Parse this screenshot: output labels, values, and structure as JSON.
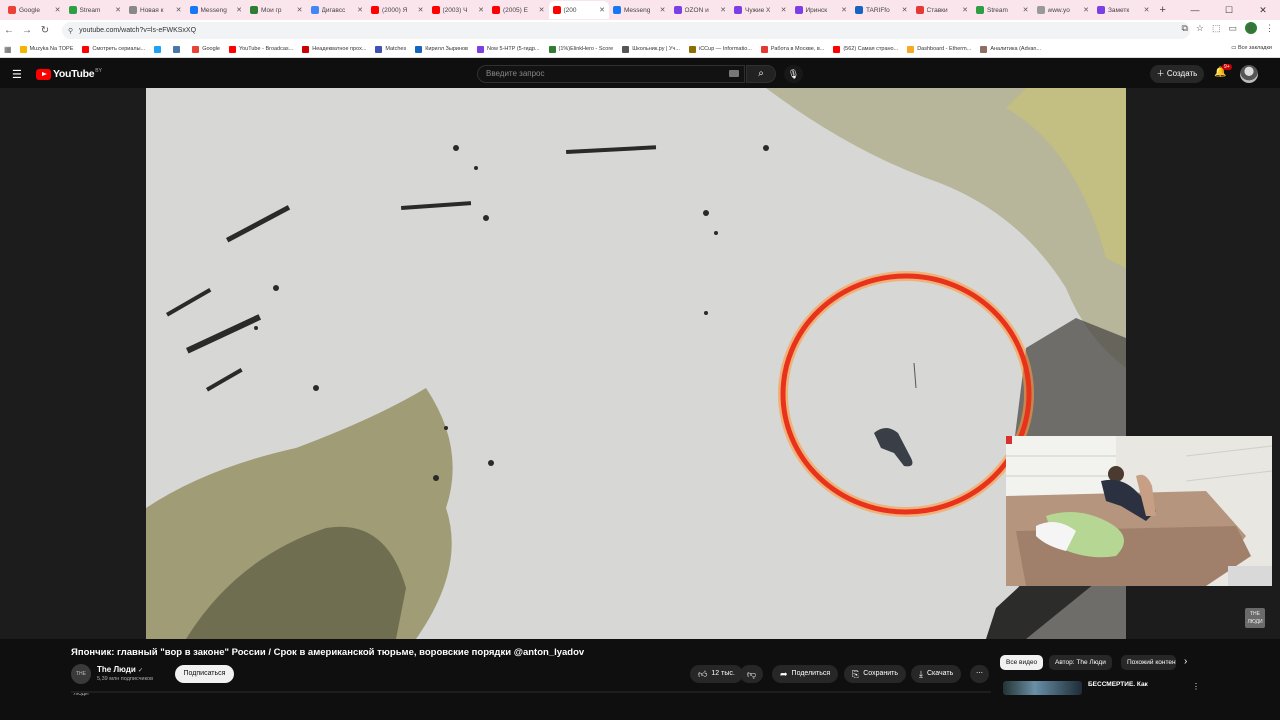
{
  "browser": {
    "tabs": [
      {
        "label": "Google",
        "color": "#ea4335"
      },
      {
        "label": "Stream",
        "color": "#2e9e44"
      },
      {
        "label": "Новая к",
        "color": "#888888"
      },
      {
        "label": "Messeng",
        "color": "#1877f2"
      },
      {
        "label": "Мои гр",
        "color": "#2e7d32"
      },
      {
        "label": "Дигавсс",
        "color": "#4285f4"
      },
      {
        "label": "(2000) Я",
        "color": "#ff0000"
      },
      {
        "label": "(2003) Ч",
        "color": "#ff0000"
      },
      {
        "label": "(2005) Е",
        "color": "#ff0000"
      },
      {
        "label": "(200",
        "color": "#ff0000"
      },
      {
        "label": "Messeng",
        "color": "#1877f2"
      },
      {
        "label": "OZON и",
        "color": "#7b3fe4"
      },
      {
        "label": "Чужие Х",
        "color": "#7b3fe4"
      },
      {
        "label": "Иринск",
        "color": "#7b3fe4"
      },
      {
        "label": "TARIFfo",
        "color": "#1565c0"
      },
      {
        "label": "Ставки",
        "color": "#e53935"
      },
      {
        "label": "Stream",
        "color": "#2e9e44"
      },
      {
        "label": "www.yo",
        "color": "#999999"
      },
      {
        "label": "Заметк",
        "color": "#7b3fe4"
      }
    ],
    "active_tab_index": 9,
    "url": "youtube.com/watch?v=ls-eFWKSxXQ",
    "profile_initial": "K",
    "bookmarks": [
      {
        "label": "Muzyka Na TOPE",
        "color": "#f4b400"
      },
      {
        "label": "Смотреть сериалы...",
        "color": "#ff0000"
      },
      {
        "label": "",
        "color": "#1da1f2"
      },
      {
        "label": "",
        "color": "#4a76a8"
      },
      {
        "label": "Google",
        "color": "#ea4335"
      },
      {
        "label": "YouTube - Broadcas...",
        "color": "#ff0000"
      },
      {
        "label": "Неадекватное прох...",
        "color": "#cc0000"
      },
      {
        "label": "Matches",
        "color": "#3f51b5"
      },
      {
        "label": "Кирилл Зыринов",
        "color": "#1565c0"
      },
      {
        "label": "Now 5-HTP (5-гидр...",
        "color": "#7b3fe4"
      },
      {
        "label": "(1%)ЕlinkHero - Score",
        "color": "#2e7d32"
      },
      {
        "label": "Школьник.ру | Уч...",
        "color": "#555555"
      },
      {
        "label": "iCCup — Informatio...",
        "color": "#8d6e00"
      },
      {
        "label": "Работа в Москве, в...",
        "color": "#e53935"
      },
      {
        "label": "(562) Самая страно...",
        "color": "#ff0000"
      },
      {
        "label": "Dashboard - Etherm...",
        "color": "#f9a825"
      },
      {
        "label": "Аналитика (Advan...",
        "color": "#8d6e63"
      }
    ],
    "all_bookmarks": "Все закладки"
  },
  "youtube": {
    "logo_text": "YouTube",
    "logo_region": "BY",
    "search_placeholder": "Введите запрос",
    "create_label": "Создать",
    "notif_count": "9+"
  },
  "video": {
    "title": "Япончик: главный \"вор в законе\" России / Срок в американской тюрьме, воровские порядки @anton_lyadov",
    "channel": "The Люди",
    "channel_badge": "THE ЛЮДИ",
    "verified": "✓",
    "subscribers": "5,39 млн подписчиков",
    "subscribe_label": "Подписаться",
    "likes": "12 тыс.",
    "share": "Поделиться",
    "save": "Сохранить",
    "download": "Скачать",
    "watermark": "THE ЛЮДИ"
  },
  "sidebar": {
    "chips": [
      "Все видео",
      "Автор: The Люди",
      "Похожий контент"
    ],
    "first_rec_title": "БЕССМЕРТИЕ. Как"
  },
  "colors": {
    "accent": "#ff0000",
    "background": "#0f0f0f"
  }
}
